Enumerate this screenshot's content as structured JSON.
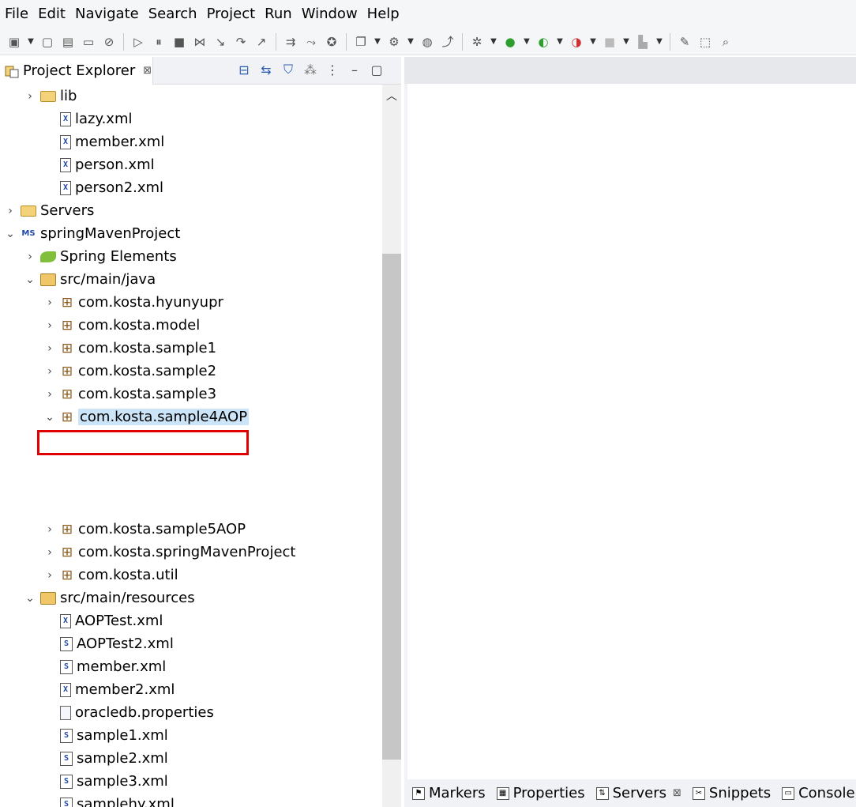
{
  "menu": [
    "File",
    "Edit",
    "Navigate",
    "Search",
    "Project",
    "Run",
    "Window",
    "Help"
  ],
  "explorer": {
    "tab_label": "Project Explorer",
    "tab_close": "⊠"
  },
  "tree": [
    {
      "label": "lib",
      "icon": "folder-icon",
      "twisty": "›"
    },
    {
      "label": "lazy.xml",
      "icon": "xml-file-icon",
      "twisty": ""
    },
    {
      "label": "member.xml",
      "icon": "xml-file-icon",
      "twisty": ""
    },
    {
      "label": "person.xml",
      "icon": "xml-file-icon",
      "twisty": ""
    },
    {
      "label": "person2.xml",
      "icon": "xml-file-icon",
      "twisty": ""
    },
    {
      "label": "Servers",
      "icon": "folder-icon",
      "twisty": "›"
    },
    {
      "label": "springMavenProject",
      "icon": "maven-project-icon",
      "twisty": "⌄"
    },
    {
      "label": "Spring Elements",
      "icon": "spring-leaf-icon",
      "twisty": "›"
    },
    {
      "label": "src/main/java",
      "icon": "source-folder-icon",
      "twisty": "⌄"
    },
    {
      "label": "com.kosta.hyunyupr",
      "icon": "package-icon",
      "twisty": "›"
    },
    {
      "label": "com.kosta.model",
      "icon": "package-icon",
      "twisty": "›"
    },
    {
      "label": "com.kosta.sample1",
      "icon": "package-icon",
      "twisty": "›"
    },
    {
      "label": "com.kosta.sample2",
      "icon": "package-icon",
      "twisty": "›"
    },
    {
      "label": "com.kosta.sample3",
      "icon": "package-icon",
      "twisty": "›"
    },
    {
      "label": "com.kosta.sample4AOP",
      "icon": "package-icon",
      "twisty": "⌄",
      "selected": true
    },
    {
      "label": "com.kosta.sample5AOP",
      "icon": "package-icon",
      "twisty": "›"
    },
    {
      "label": "com.kosta.springMavenProject",
      "icon": "package-icon",
      "twisty": "›"
    },
    {
      "label": "com.kosta.util",
      "icon": "package-icon",
      "twisty": "›"
    },
    {
      "label": "src/main/resources",
      "icon": "source-folder-icon",
      "twisty": "⌄"
    },
    {
      "label": "AOPTest.xml",
      "icon": "xml-file-icon",
      "twisty": ""
    },
    {
      "label": "AOPTest2.xml",
      "icon": "spring-xml-icon",
      "twisty": ""
    },
    {
      "label": "member.xml",
      "icon": "spring-xml-icon",
      "twisty": ""
    },
    {
      "label": "member2.xml",
      "icon": "xml-file-icon",
      "twisty": ""
    },
    {
      "label": "oracledb.properties",
      "icon": "properties-file-icon",
      "twisty": ""
    },
    {
      "label": "sample1.xml",
      "icon": "spring-xml-icon",
      "twisty": ""
    },
    {
      "label": "sample2.xml",
      "icon": "spring-xml-icon",
      "twisty": ""
    },
    {
      "label": "sample3.xml",
      "icon": "spring-xml-icon",
      "twisty": ""
    },
    {
      "label": "samplehy.xml",
      "icon": "spring-xml-icon",
      "twisty": ""
    }
  ],
  "bottom_tabs": [
    {
      "label": "Markers",
      "icon": "markers-icon"
    },
    {
      "label": "Properties",
      "icon": "properties-icon"
    },
    {
      "label": "Servers",
      "icon": "servers-icon",
      "active": true,
      "close": "⊠"
    },
    {
      "label": "Snippets",
      "icon": "snippets-icon"
    },
    {
      "label": "Console",
      "icon": "console-icon"
    }
  ],
  "colors": {
    "selection": "#cce4f7",
    "highlight_box": "#e00000"
  }
}
